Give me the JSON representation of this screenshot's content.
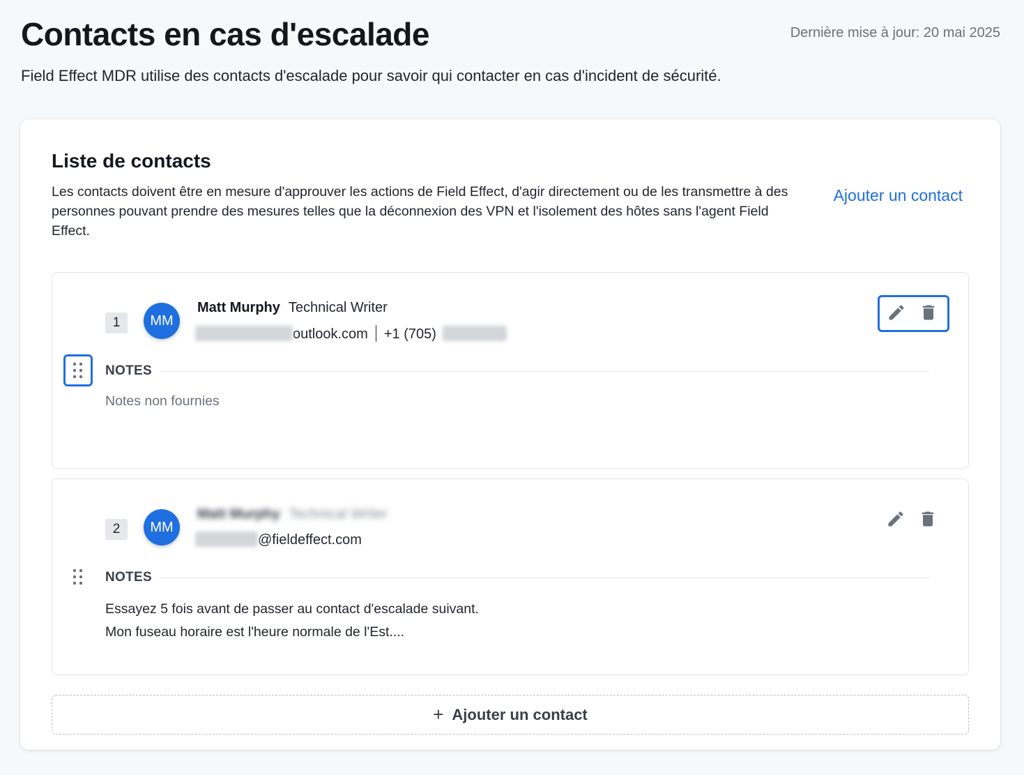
{
  "header": {
    "title": "Contacts en cas d'escalade",
    "last_updated": "Dernière mise à jour: 20 mai 2025",
    "subtitle": "Field Effect MDR utilise des contacts d'escalade pour savoir qui contacter en cas d'incident de sécurité."
  },
  "list": {
    "title": "Liste de contacts",
    "description": "Les contacts doivent être en mesure d'approuver les actions de Field Effect, d'agir directement ou de les transmettre à des personnes pouvant prendre des mesures telles que la déconnexion des VPN et l'isolement des hôtes sans l'agent Field Effect.",
    "add_link": "Ajouter un contact",
    "notes_label": "NOTES",
    "add_bar_label": "Ajouter un contact",
    "add_bar_icon": "plus-icon"
  },
  "contacts": [
    {
      "rank": "1",
      "initials": "MM",
      "name": "Matt Murphy",
      "role": "Technical Writer",
      "email_domain": "outlook.com",
      "phone_prefix": "+1 (705)",
      "notes_empty": "Notes non fournies"
    },
    {
      "rank": "2",
      "initials": "MM",
      "name_blurred": "Matt Murphy",
      "role_blurred": "Technical Writer",
      "email_domain": "@fieldeffect.com",
      "notes_lines": [
        "Essayez 5 fois avant de passer au contact d'escalade suivant.",
        "Mon fuseau horaire est l'heure normale de l'Est...."
      ]
    }
  ],
  "icons": {
    "edit": "pencil-icon",
    "delete": "trash-icon",
    "drag": "drag-handle-icon"
  },
  "colors": {
    "accent": "#1f6fe0",
    "avatar_bg": "#1f6fe0",
    "icon_gray": "#6b717a"
  }
}
